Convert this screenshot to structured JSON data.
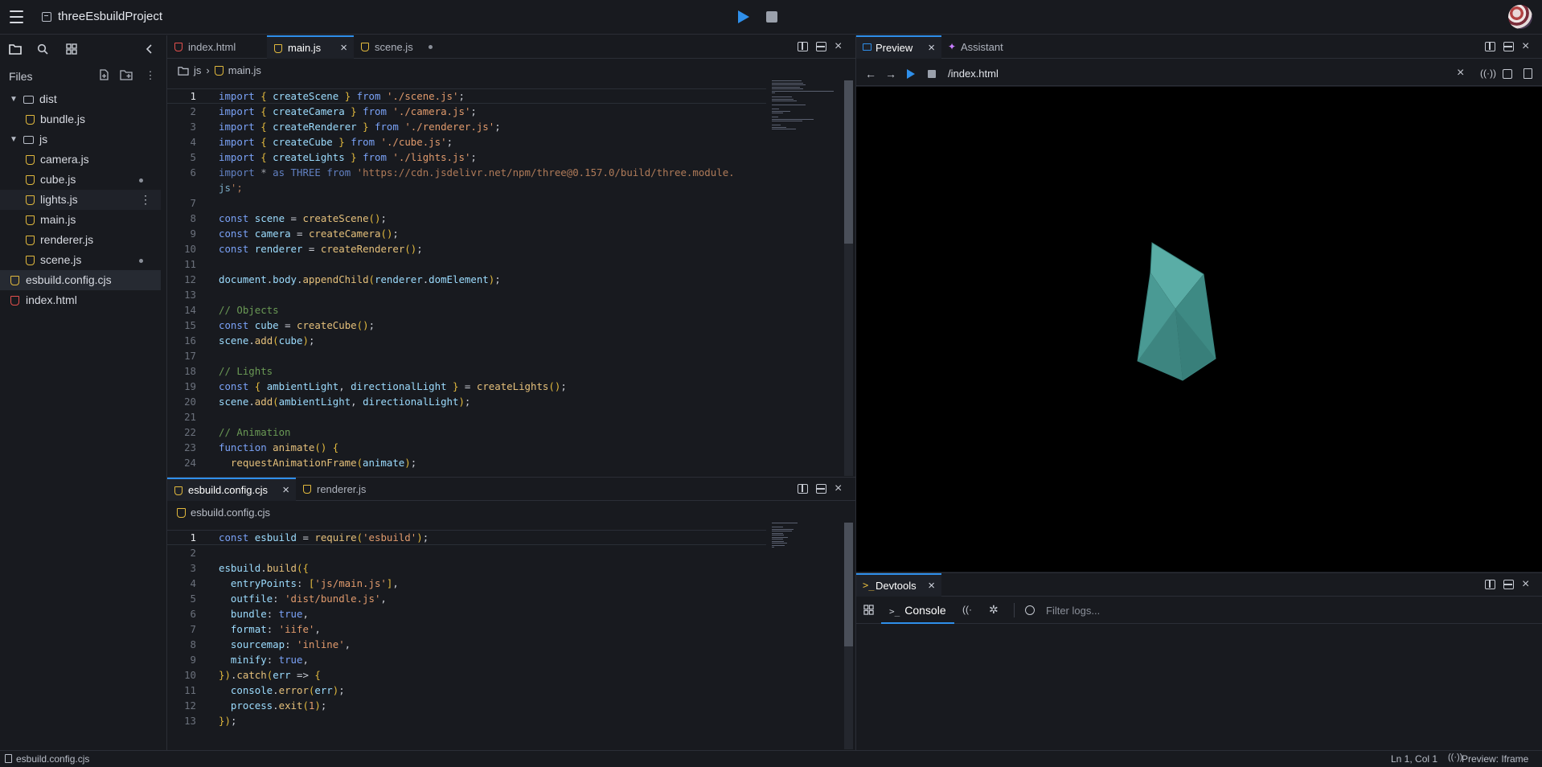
{
  "app": {
    "project_name": "threeEsbuildProject"
  },
  "sidebar": {
    "header": "Files",
    "tree": [
      {
        "type": "folder",
        "name": "dist",
        "depth": 0
      },
      {
        "type": "file",
        "name": "bundle.js",
        "depth": 1,
        "kind": "js"
      },
      {
        "type": "folder",
        "name": "js",
        "depth": 0
      },
      {
        "type": "file",
        "name": "camera.js",
        "depth": 1,
        "kind": "js"
      },
      {
        "type": "file",
        "name": "cube.js",
        "depth": 1,
        "kind": "js",
        "modified": true
      },
      {
        "type": "file",
        "name": "lights.js",
        "depth": 1,
        "kind": "js",
        "hovered": true
      },
      {
        "type": "file",
        "name": "main.js",
        "depth": 1,
        "kind": "js"
      },
      {
        "type": "file",
        "name": "renderer.js",
        "depth": 1,
        "kind": "js"
      },
      {
        "type": "file",
        "name": "scene.js",
        "depth": 1,
        "kind": "js",
        "modified": true
      },
      {
        "type": "file",
        "name": "esbuild.config.cjs",
        "depth": 0,
        "kind": "js",
        "selected": true
      },
      {
        "type": "file",
        "name": "index.html",
        "depth": 0,
        "kind": "html"
      }
    ]
  },
  "editor_top": {
    "tabs": [
      {
        "label": "index.html",
        "kind": "html"
      },
      {
        "label": "main.js",
        "kind": "js",
        "active": true
      },
      {
        "label": "scene.js",
        "kind": "js",
        "modified": true
      }
    ],
    "breadcrumb": [
      "js",
      "main.js"
    ],
    "lines": [
      "import { createScene } from './scene.js';",
      "import { createCamera } from './camera.js';",
      "import { createRenderer } from './renderer.js';",
      "import { createCube } from './cube.js';",
      "import { createLights } from './lights.js';",
      "import * as THREE from 'https://cdn.jsdelivr.net/npm/three@0.157.0/build/three.module.",
      "js';",
      "",
      "const scene = createScene();",
      "const camera = createCamera();",
      "const renderer = createRenderer();",
      "",
      "document.body.appendChild(renderer.domElement);",
      "",
      "// Objects",
      "const cube = createCube();",
      "scene.add(cube);",
      "",
      "// Lights",
      "const { ambientLight, directionalLight } = createLights();",
      "scene.add(ambientLight, directionalLight);",
      "",
      "// Animation",
      "function animate() {",
      "  requestAnimationFrame(animate);"
    ],
    "line_numbers": [
      "1",
      "2",
      "3",
      "4",
      "5",
      "6",
      "",
      "7",
      "8",
      "9",
      "10",
      "11",
      "12",
      "13",
      "14",
      "15",
      "16",
      "17",
      "18",
      "19",
      "20",
      "21",
      "22",
      "23",
      "24"
    ]
  },
  "editor_bottom": {
    "tabs": [
      {
        "label": "esbuild.config.cjs",
        "kind": "js",
        "active": true
      },
      {
        "label": "renderer.js",
        "kind": "js"
      }
    ],
    "breadcrumb": [
      "esbuild.config.cjs"
    ],
    "lines": [
      "const esbuild = require('esbuild');",
      "",
      "esbuild.build({",
      "  entryPoints: ['js/main.js'],",
      "  outfile: 'dist/bundle.js',",
      "  bundle: true,",
      "  format: 'iife',",
      "  sourcemap: 'inline',",
      "  minify: true,",
      "}).catch(err => {",
      "  console.error(err);",
      "  process.exit(1);",
      "});"
    ]
  },
  "preview": {
    "tabs": [
      {
        "label": "Preview",
        "active": true
      },
      {
        "label": "Assistant"
      }
    ],
    "url": "/index.html",
    "cube_color": "#4a9a94"
  },
  "devtools": {
    "tab_label": "Devtools",
    "console_label": "Console",
    "filter_placeholder": "Filter logs..."
  },
  "status": {
    "file": "esbuild.config.cjs",
    "position": "Ln 1, Col 1",
    "preview_mode": "Preview: Iframe"
  },
  "colors": {
    "accent": "#2f8fea",
    "js_icon": "#e2b93d",
    "html_icon": "#e4504d"
  }
}
